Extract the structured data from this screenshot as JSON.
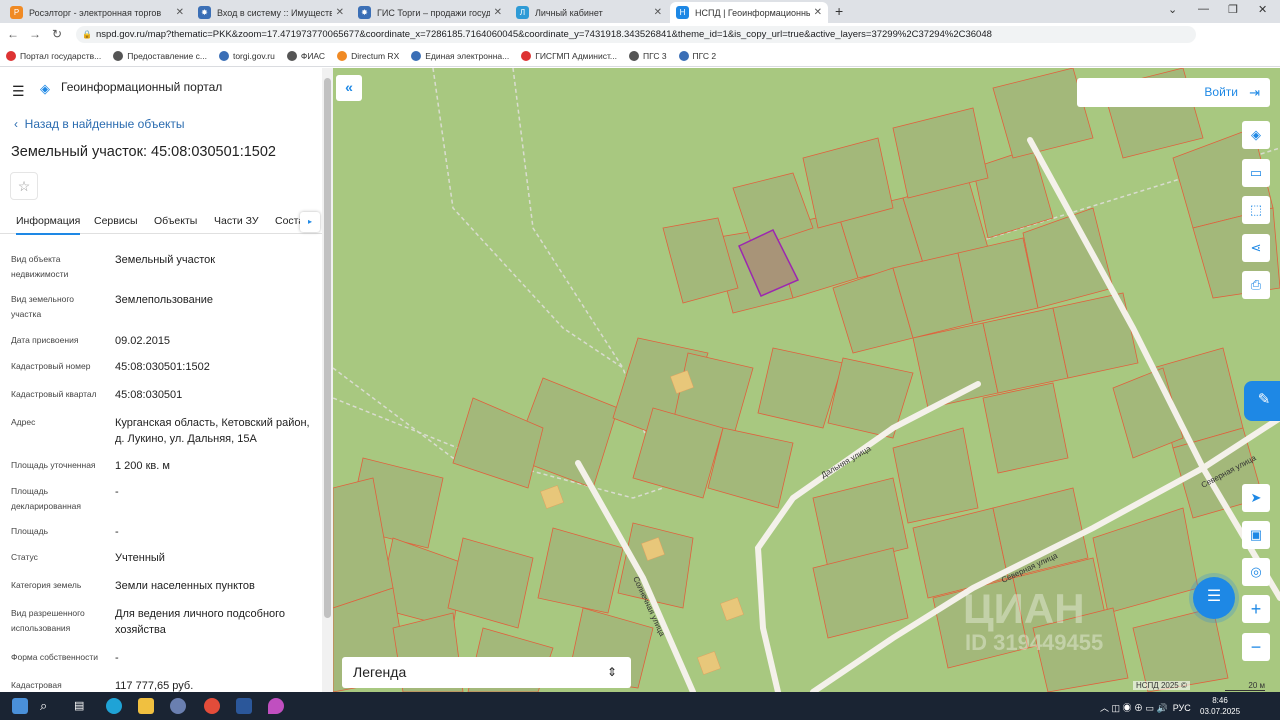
{
  "browser": {
    "tabs": [
      {
        "title": "Росэлторг - электронная торгов",
        "color": "#f08a24",
        "letter": "Р"
      },
      {
        "title": "Вход в систему :: Имущественн",
        "color": "#3b6fb6",
        "letter": "✸"
      },
      {
        "title": "ГИС Торги – продажи государс",
        "color": "#3b6fb6",
        "letter": "✸"
      },
      {
        "title": "Личный кабинет",
        "color": "#2e9bd6",
        "letter": "Л"
      },
      {
        "title": "НСПД | Геоинформационный п",
        "color": "#1e88e5",
        "letter": "Н"
      }
    ],
    "new_tab": "+",
    "url": "nspd.gov.ru/map?thematic=PKK&zoom=17.471973770065677&coordinate_x=7286185.7164060045&coordinate_y=7431918.343526841&theme_id=1&is_copy_url=true&active_layers=37299%2C37294%2C36048",
    "bookmarks": [
      {
        "label": "Портал государств...",
        "color": "#d33"
      },
      {
        "label": "Предоставление с...",
        "color": "#555"
      },
      {
        "label": "torgi.gov.ru",
        "color": "#3b6fb6"
      },
      {
        "label": "ФИАС",
        "color": "#555"
      },
      {
        "label": "Directum RX",
        "color": "#f08a24"
      },
      {
        "label": "Единая электронна...",
        "color": "#3b6fb6"
      },
      {
        "label": "ГИСГМП Админист...",
        "color": "#d33"
      },
      {
        "label": "ПГС 3",
        "color": "#555"
      },
      {
        "label": "ПГС 2",
        "color": "#3b6fb6"
      }
    ]
  },
  "panel": {
    "portal_name": "Геоинформационный портал",
    "back_label": "Назад в найденные объекты",
    "title": "Земельный участок: 45:08:030501:1502",
    "star": "☆",
    "tabs": [
      "Информация",
      "Сервисы",
      "Объекты",
      "Части ЗУ",
      "Соста"
    ],
    "fields": [
      {
        "label": "Вид объекта недвижимости",
        "value": "Земельный участок"
      },
      {
        "label": "Вид земельного участка",
        "value": "Землепользование"
      },
      {
        "label": "Дата присвоения",
        "value": "09.02.2015"
      },
      {
        "label": "Кадастровый номер",
        "value": "45:08:030501:1502"
      },
      {
        "label": "Кадастровый квартал",
        "value": "45:08:030501"
      },
      {
        "label": "Адрес",
        "value": "Курганская область, Кетовский район, д. Лукино, ул. Дальняя, 15А"
      },
      {
        "label": "Площадь уточненная",
        "value": "1 200 кв. м"
      },
      {
        "label": "Площадь декларированная",
        "value": "-"
      },
      {
        "label": "Площадь",
        "value": "-"
      },
      {
        "label": "Статус",
        "value": "Учтенный"
      },
      {
        "label": "Категория земель",
        "value": "Земли населенных пунктов"
      },
      {
        "label": "Вид разрешенного использования",
        "value": "Для ведения личного подсобного хозяйства"
      },
      {
        "label": "Форма собственности",
        "value": "-"
      },
      {
        "label": "Кадастровая",
        "value": "117 777,65 руб."
      }
    ]
  },
  "map": {
    "login_label": "Войти",
    "legend_label": "Легенда",
    "street_labels": [
      "Дальняя улица",
      "Северная улица",
      "Северная улица",
      "Солнечная улица"
    ],
    "watermark": "ЦИАН",
    "watermark_id": "ID 319449455",
    "copyright": "НСПД 2025 ©",
    "scale": "20 м",
    "colors": {
      "background": "#a8c880",
      "parcel_fill": "#a3b87a",
      "parcel_stroke": "#e0603c",
      "selected_stroke": "#9c27b0",
      "road": "#f4f1ea"
    }
  },
  "taskbar": {
    "lang": "РУС",
    "time": "8:46",
    "date": "03.07.2025"
  }
}
